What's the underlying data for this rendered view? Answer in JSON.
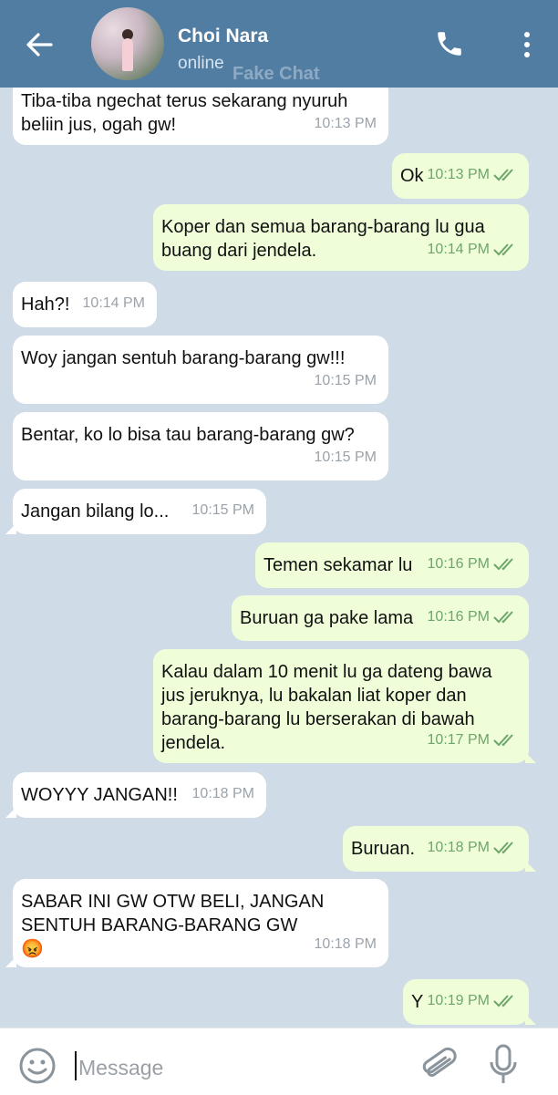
{
  "header": {
    "contact_name": "Choi Nara",
    "status": "online",
    "watermark": "Fake Chat",
    "back_icon": "arrow-left-icon",
    "call_icon": "phone-icon",
    "menu_icon": "more-vertical-icon",
    "background_color": "#527da3"
  },
  "chat": {
    "background_color": "#cfdbe6",
    "incoming_bubble_color": "#ffffff",
    "outgoing_bubble_color": "#effed9",
    "read_check_color": "#6da66b",
    "messages": [
      {
        "dir": "in",
        "text": "Tiba-tiba ngechat terus sekarang nyuruh\nbeliin jus, ogah gw!",
        "time": "10:13 PM"
      },
      {
        "dir": "out",
        "text": "Ok",
        "time": "10:13 PM",
        "read": true
      },
      {
        "dir": "out",
        "text": "Koper dan semua barang-barang lu gua\nbuang dari jendela.",
        "time": "10:14 PM",
        "read": true
      },
      {
        "dir": "in",
        "text": "Hah?!",
        "time": "10:14 PM"
      },
      {
        "dir": "in",
        "text": "Woy jangan sentuh barang-barang gw!!!",
        "time": "10:15 PM"
      },
      {
        "dir": "in",
        "text": "Bentar, ko lo bisa tau barang-barang gw?",
        "time": "10:15 PM"
      },
      {
        "dir": "in",
        "text": "Jangan bilang lo...",
        "time": "10:15 PM"
      },
      {
        "dir": "out",
        "text": "Temen sekamar lu",
        "time": "10:16 PM",
        "read": true
      },
      {
        "dir": "out",
        "text": "Buruan ga pake lama",
        "time": "10:16 PM",
        "read": true
      },
      {
        "dir": "out",
        "text": "Kalau dalam 10 menit lu ga dateng bawa\njus jeruknya, lu bakalan liat koper dan\nbarang-barang lu berserakan di bawah\njendela.",
        "time": "10:17 PM",
        "read": true
      },
      {
        "dir": "in",
        "text": "WOYYY JANGAN!!",
        "time": "10:18 PM"
      },
      {
        "dir": "out",
        "text": "Buruan.",
        "time": "10:18 PM",
        "read": true
      },
      {
        "dir": "in",
        "text": "SABAR INI GW OTW BELI, JANGAN\nSENTUH BARANG-BARANG GW\n😡",
        "time": "10:18 PM"
      },
      {
        "dir": "out",
        "text": "Y",
        "time": "10:19 PM",
        "read": true
      }
    ]
  },
  "input_bar": {
    "placeholder": "Message",
    "value": "",
    "emoji_icon": "smiley-icon",
    "attach_icon": "paperclip-icon",
    "mic_icon": "microphone-icon"
  }
}
